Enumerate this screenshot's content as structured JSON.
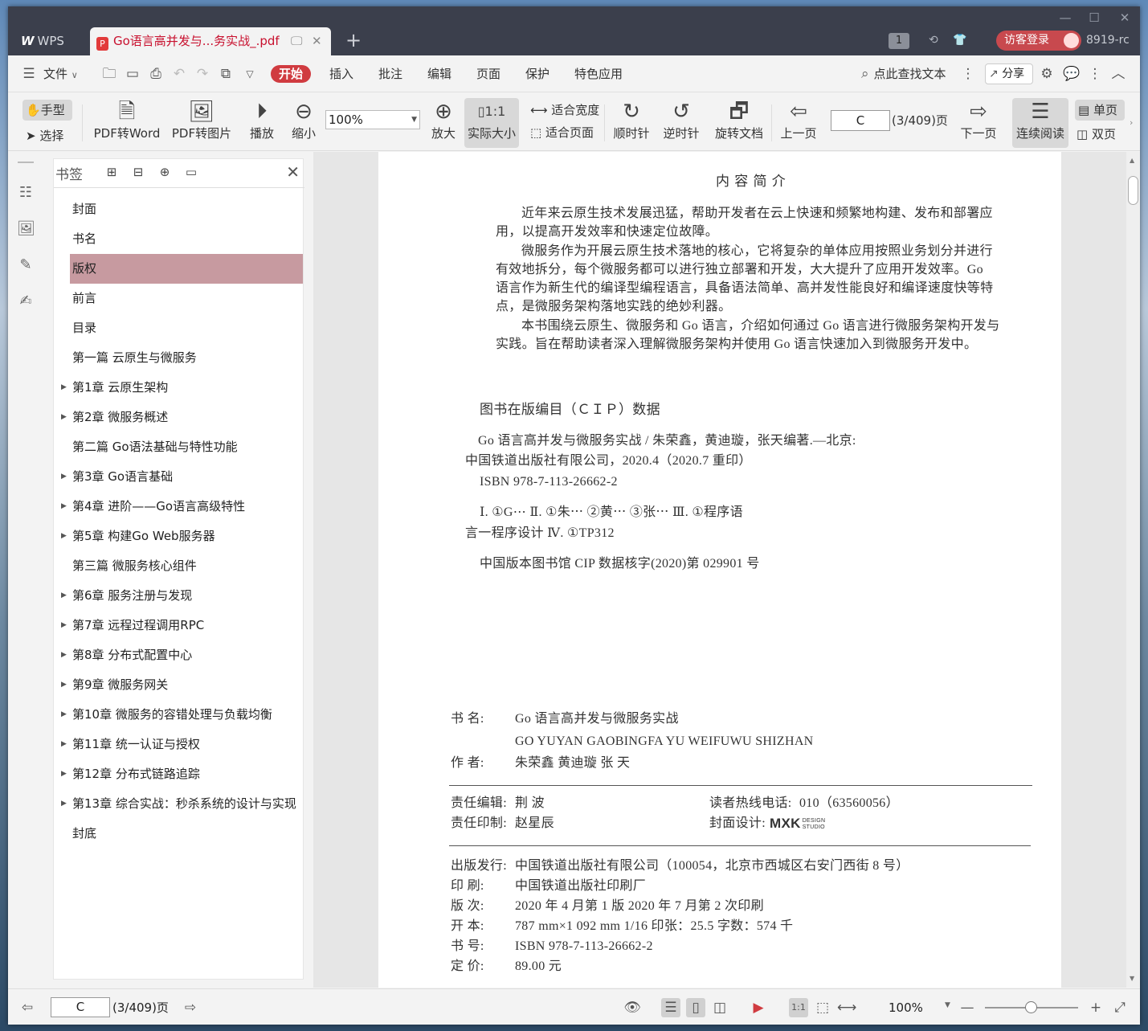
{
  "titlebar": {
    "app_tab": "WPS",
    "doc_tab": "Go语言高并发与...务实战_.pdf",
    "badge": "1",
    "login": "访客登录",
    "version": "8919-rc"
  },
  "menubar": {
    "file": "文件",
    "items": [
      "开始",
      "插入",
      "批注",
      "编辑",
      "页面",
      "保护",
      "特色应用"
    ],
    "active": "开始",
    "find": "点此查找文本",
    "share": "分享"
  },
  "toolbar": {
    "hand": "手型",
    "select": "选择",
    "pdf_to_word": "PDF转Word",
    "pdf_to_image": "PDF转图片",
    "play": "播放",
    "zoom_out": "缩小",
    "zoom_value": "100%",
    "zoom_in": "放大",
    "actual_size": "实际大小",
    "fit_width": "适合宽度",
    "fit_page": "适合页面",
    "rotate_cw": "顺时针",
    "rotate_ccw": "逆时针",
    "rotate_doc": "旋转文档",
    "prev_page": "上一页",
    "page_input": "C",
    "page_count": "(3/409)页",
    "next_page": "下一页",
    "continuous": "连续阅读",
    "single": "单页",
    "double": "双页"
  },
  "bookmarks": {
    "title": "书签",
    "items": [
      {
        "label": "封面",
        "expandable": false
      },
      {
        "label": "书名",
        "expandable": false
      },
      {
        "label": "版权",
        "expandable": false,
        "selected": true
      },
      {
        "label": "前言",
        "expandable": false
      },
      {
        "label": "目录",
        "expandable": false
      },
      {
        "label": "第一篇  云原生与微服务",
        "expandable": false
      },
      {
        "label": "第1章  云原生架构",
        "expandable": true
      },
      {
        "label": "第2章  微服务概述",
        "expandable": true
      },
      {
        "label": "第二篇  Go语法基础与特性功能",
        "expandable": false
      },
      {
        "label": "第3章  Go语言基础",
        "expandable": true
      },
      {
        "label": "第4章  进阶——Go语言高级特性",
        "expandable": true
      },
      {
        "label": "第5章  构建Go Web服务器",
        "expandable": true
      },
      {
        "label": "第三篇  微服务核心组件",
        "expandable": false
      },
      {
        "label": "第6章  服务注册与发现",
        "expandable": true
      },
      {
        "label": "第7章  远程过程调用RPC",
        "expandable": true
      },
      {
        "label": "第8章  分布式配置中心",
        "expandable": true
      },
      {
        "label": "第9章  微服务网关",
        "expandable": true
      },
      {
        "label": "第10章  微服务的容错处理与负载均衡",
        "expandable": true
      },
      {
        "label": "第11章  统一认证与授权",
        "expandable": true
      },
      {
        "label": "第12章  分布式链路追踪",
        "expandable": true
      },
      {
        "label": "第13章  综合实战：秒杀系统的设计与实现",
        "expandable": true
      },
      {
        "label": "封底",
        "expandable": false
      }
    ]
  },
  "page": {
    "summary_title": "内 容 简 介",
    "summary": [
      "近年来云原生技术发展迅猛，帮助开发者在云上快速和频繁地构建、发布和部署应",
      "用，以提高开发效率和快速定位故障。",
      "微服务作为开展云原生技术落地的核心，它将复杂的单体应用按照业务划分并进行",
      "有效地拆分，每个微服务都可以进行独立部署和开发，大大提升了应用开发效率。Go",
      "语言作为新生代的编译型编程语言，具备语法简单、高并发性能良好和编译速度快等特",
      "点，是微服务架构落地实践的绝妙利器。",
      "本书围绕云原生、微服务和 Go 语言，介绍如何通过 Go 语言进行微服务架构开发与",
      "实践。旨在帮助读者深入理解微服务架构并使用 Go 语言快速加入到微服务开发中。"
    ],
    "cip_title": "图书在版编目（ＣＩＰ）数据",
    "cip": [
      "Go 语言高并发与微服务实战 / 朱荣鑫，黄迪璇，张天编著.—北京:",
      "中国铁道出版社有限公司，2020.4（2020.7 重印）",
      "ISBN 978-7-113-26662-2",
      "Ⅰ. ①G⋯ Ⅱ. ①朱⋯ ②黄⋯ ③张⋯ Ⅲ. ①程序语",
      "言一程序设计 Ⅳ. ①TP312",
      "中国版本图书馆 CIP 数据核字(2020)第 029901 号"
    ],
    "info": {
      "book_label": "书    名:",
      "book_name": "Go 语言高并发与微服务实战",
      "book_pinyin": "GO YUYAN GAOBINGFA YU WEIFUWU SHIZHAN",
      "author_label": "作    者:",
      "authors": "朱荣鑫  黄迪璇  张  天",
      "editor_label": "责任编辑:",
      "editor": "荆  波",
      "hotline_label": "读者热线电话:",
      "hotline": "010（63560056）",
      "print_label": "责任印制:",
      "printer_person": "赵星辰",
      "cover_label": "封面设计:",
      "cover_logo": "MXK",
      "cover_logo_sub1": "DESIGN",
      "cover_logo_sub2": "STUDIO",
      "publisher_label": "出版发行:",
      "publisher": "中国铁道出版社有限公司（100054，北京市西城区右安门西街 8 号）",
      "printing_label": "印    刷:",
      "printing": "中国铁道出版社印刷厂",
      "edition_label": "版    次:",
      "edition": "2020 年 4 月第 1 版   2020 年 7 月第 2 次印刷",
      "format_label": "开    本:",
      "format": "787 mm×1 092 mm  1/16   印张：25.5   字数：574 千",
      "isbn_label": "书    号:",
      "isbn": "ISBN 978-7-113-26662-2",
      "price_label": "定    价:",
      "price": "89.00 元"
    }
  },
  "statusbar": {
    "page_input": "C",
    "page_count": "(3/409)页",
    "zoom": "100%"
  }
}
